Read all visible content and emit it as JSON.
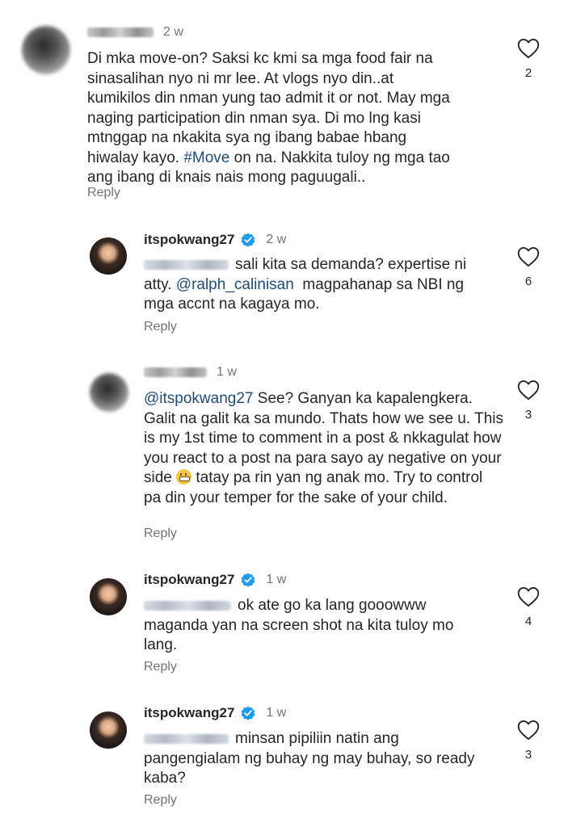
{
  "comments": [
    {
      "time": "2 w",
      "text": "Di mka move-on? Saksi kc kmi sa mga food fair na sinasalihan nyo ni mr lee. At vlogs nyo din..at kumikilos din nman yung tao admit it or not. May mga naging participation din nman sya. Di mo lng kasi mtnggap na nkakita sya ng ibang babae hbang hiwalay kayo.",
      "hashtag": "#Move",
      "text_after": "on na. Nakkita tuloy ng mga tao ang ibang di knais nais mong paguugali..",
      "reply_label": "Reply",
      "likes": "2"
    },
    {
      "username": "itspokwang27",
      "time": "2 w",
      "text_a": "sali kita sa demanda? expertise ni atty.",
      "mention": "@ralph_calinisan",
      "text_b": "magpahanap sa NBI ng mga accnt na kagaya mo.",
      "reply_label": "Reply",
      "likes": "6"
    },
    {
      "time": "1 w",
      "mention": "@itspokwang27",
      "text_a": "See? Ganyan ka kapalengkera. Galit na galit ka sa mundo. Thats how we see u. This is my 1st time to comment in a post & nkkagulat how you react to a post na para sayo ay negative on your side",
      "text_b": "tatay pa rin yan ng anak mo. Try to control pa din your temper for the sake of your child.",
      "reply_label": "Reply",
      "likes": "3"
    },
    {
      "username": "itspokwang27",
      "time": "1 w",
      "text": "ok ate go ka lang gooowww maganda yan na screen shot na kita tuloy mo lang.",
      "reply_label": "Reply",
      "likes": "4"
    },
    {
      "username": "itspokwang27",
      "time": "1 w",
      "text": "minsan pipiliin natin ang pangengialam ng buhay ng may buhay, so ready kaba?",
      "reply_label": "Reply",
      "likes": "3"
    }
  ]
}
